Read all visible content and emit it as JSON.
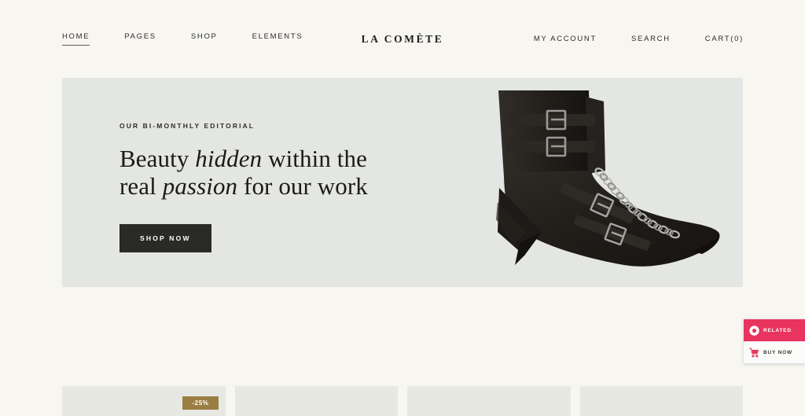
{
  "site": {
    "logo": "LA COMÈTE",
    "background_color": "#f8f6f1"
  },
  "nav": {
    "left_items": [
      {
        "label": "HOME",
        "active": true
      },
      {
        "label": "PAGES",
        "active": false
      },
      {
        "label": "SHOP",
        "active": false
      },
      {
        "label": "ELEMENTS",
        "active": false
      }
    ],
    "right_items": [
      {
        "label": "MY ACCOUNT"
      },
      {
        "label": "SEARCH"
      },
      {
        "label": "CART(0)"
      }
    ]
  },
  "hero": {
    "background_color": "#e4e6e3",
    "eyebrow": "OUR BI-MONTHLY EDITORIAL",
    "headline_line1_part1": "Beauty ",
    "headline_line1_italic": "hidden",
    "headline_line1_part2": " within the",
    "headline_line2_part1": "real ",
    "headline_line2_italic": "passion",
    "headline_line2_part2": " for our work",
    "cta_label": "SHOP NOW",
    "cta_color": "#2a2a28",
    "product_image_alt": "black suede pointed-toe ankle boot with silver buckles and chain lacing"
  },
  "products": {
    "cards": [
      {
        "badge": "-25%"
      },
      {
        "badge": null
      },
      {
        "badge": null
      },
      {
        "badge": null
      }
    ],
    "badge_color": "#9a7e43",
    "card_color": "#e8e8e3"
  },
  "widget": {
    "related_label": "RELATED",
    "related_icon": "record-circle-icon",
    "related_color": "#e8345f",
    "buy_label": "BUY NOW",
    "buy_icon": "shopping-cart-icon",
    "buy_icon_color": "#e8345f"
  }
}
